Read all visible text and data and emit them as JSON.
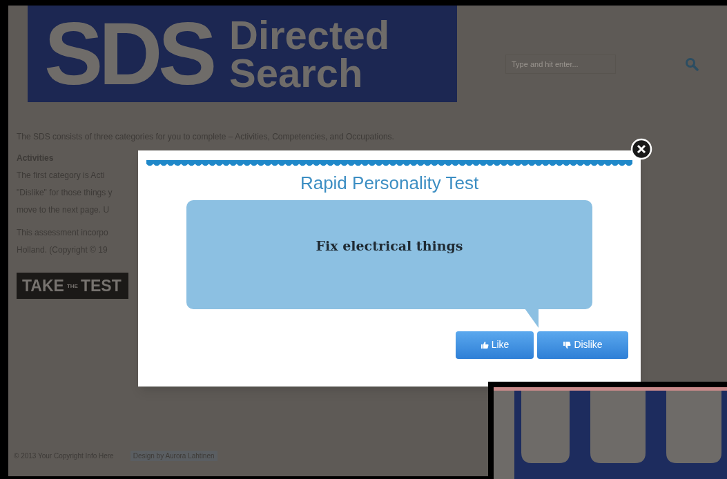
{
  "header": {
    "logo": {
      "big": "SDS",
      "line_1": "Directed",
      "line_2": "Search"
    },
    "search": {
      "placeholder": "Type and hit enter..."
    }
  },
  "content": {
    "intro": "The SDS consists of three categories for you to complete – Activities, Competencies, and Occupations.",
    "heading": "Activities",
    "lines": [
      "The first category is Acti",
      "\"Dislike\" for those things y",
      "move to the next page. U"
    ],
    "lines_2": [
      "This assessment incorpo",
      "Holland. (Copyright © 19"
    ],
    "take_test": {
      "word_1": "TAKE",
      "word_2": "THE",
      "word_3": "TEST"
    }
  },
  "footer": {
    "copyright": "© 2013 Your Copyright Info Here",
    "credit": "Design by Aurora Lahtinen"
  },
  "modal": {
    "title": "Rapid Personality Test",
    "question": "Fix electrical things",
    "buttons": [
      {
        "kind": "like",
        "label": "Like"
      },
      {
        "kind": "dislike",
        "label": "Dislike"
      }
    ]
  }
}
